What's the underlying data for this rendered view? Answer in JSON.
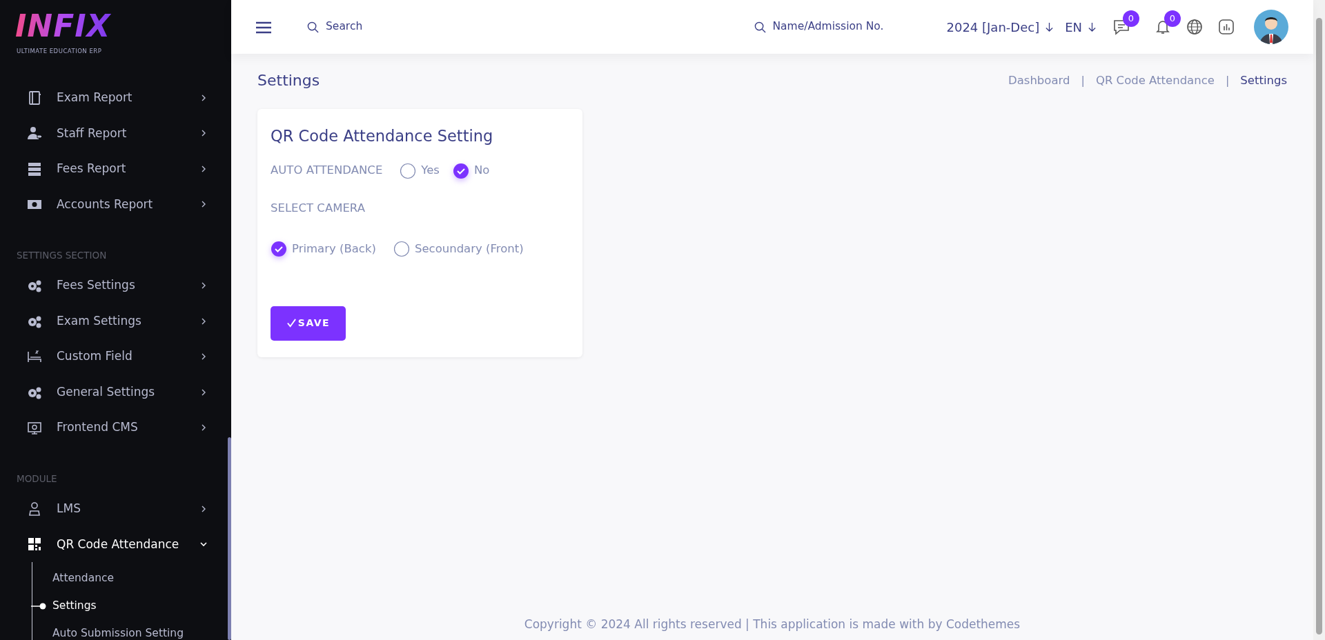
{
  "logo": {
    "name": "INFIX",
    "tagline": "ULTIMATE EDUCATION ERP"
  },
  "sidebar": {
    "sections": [
      {
        "items": [
          {
            "label": "Exam Report",
            "expanded": false
          },
          {
            "label": "Staff Report",
            "expanded": false
          },
          {
            "label": "Fees Report",
            "expanded": false
          },
          {
            "label": "Accounts Report",
            "expanded": false
          }
        ]
      },
      {
        "heading": "SETTINGS SECTION",
        "items": [
          {
            "label": "Fees Settings",
            "expanded": false
          },
          {
            "label": "Exam Settings",
            "expanded": false
          },
          {
            "label": "Custom Field",
            "expanded": false
          },
          {
            "label": "General Settings",
            "expanded": false
          },
          {
            "label": "Frontend CMS",
            "expanded": false
          }
        ]
      },
      {
        "heading": "MODULE",
        "items": [
          {
            "label": "LMS",
            "expanded": false
          },
          {
            "label": "QR Code Attendance",
            "expanded": true,
            "children": [
              {
                "label": "Attendance",
                "selected": false
              },
              {
                "label": "Settings",
                "selected": true
              },
              {
                "label": "Auto Submission Setting",
                "selected": false
              }
            ]
          }
        ]
      }
    ]
  },
  "topbar": {
    "search": {
      "placeholder": "Search"
    },
    "student_search": {
      "placeholder": "Name/Admission No."
    },
    "session": "2024 [Jan-Dec]",
    "language": "EN",
    "message_count": "0",
    "notification_count": "0"
  },
  "page_title": "Settings",
  "breadcrumbs": [
    {
      "label": "Dashboard",
      "selected": false
    },
    {
      "label": "QR Code Attendance",
      "selected": false
    },
    {
      "label": "Settings",
      "selected": true
    }
  ],
  "breadcrumb_separators": [
    "|",
    "|"
  ],
  "card": {
    "title": "QR Code Attendance Setting",
    "fields": [
      {
        "label": "AUTO ATTENDANCE",
        "kind": "inline",
        "options": [
          {
            "label": "Yes",
            "selected": false
          },
          {
            "label": "No",
            "selected": true
          }
        ]
      },
      {
        "label": "SELECT CAMERA",
        "kind": "stacked",
        "options": [
          {
            "label": "Primary (Back)",
            "selected": true
          },
          {
            "label": "Secoundary (Front)",
            "selected": false
          }
        ]
      }
    ],
    "save_button": "SAVE"
  },
  "footer": "Copyright © 2024 All rights reserved | This application is made with by Codethemes"
}
